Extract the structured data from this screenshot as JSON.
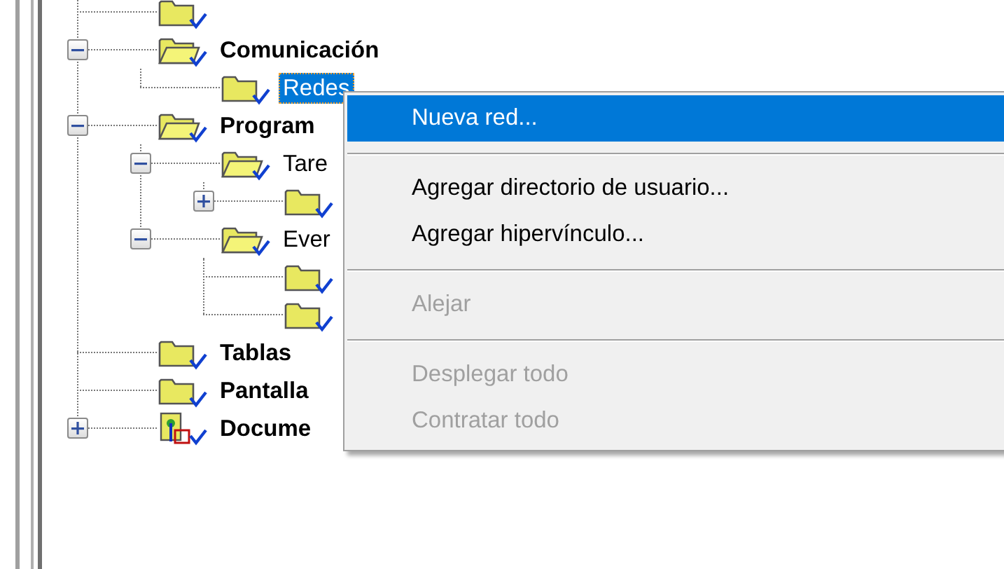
{
  "tree": [
    {
      "kind": "folder",
      "selected": false
    },
    {
      "kind": "folder",
      "label": "Comunicación",
      "expanded": true,
      "selected": false,
      "children": [
        {
          "kind": "folder",
          "label": "Redes",
          "selected": true
        }
      ]
    },
    {
      "kind": "folder",
      "label": "Program",
      "expanded": true,
      "selected": false,
      "children": [
        {
          "kind": "folder",
          "label": "Tare",
          "expanded": true,
          "selected": false,
          "children": [
            {
              "kind": "folder",
              "expanded": false,
              "selected": false
            }
          ]
        },
        {
          "kind": "folder",
          "label": "Ever",
          "expanded": true,
          "selected": false,
          "children": [
            {
              "kind": "folder",
              "selected": false
            },
            {
              "kind": "folder",
              "selected": false
            }
          ]
        }
      ]
    },
    {
      "kind": "folder",
      "label": "Tablas",
      "selected": false
    },
    {
      "kind": "folder",
      "label": "Pantalla",
      "selected": false
    },
    {
      "kind": "document",
      "label": "Docume",
      "expanded": false,
      "selected": false
    }
  ],
  "context_menu": {
    "items": [
      {
        "kind": "item",
        "label": "Nueva red...",
        "selected": true,
        "disabled": false
      },
      {
        "kind": "separator"
      },
      {
        "kind": "item",
        "label": "Agregar directorio de usuario...",
        "selected": false,
        "disabled": false
      },
      {
        "kind": "item",
        "label": "Agregar hipervínculo...",
        "selected": false,
        "disabled": false
      },
      {
        "kind": "separator"
      },
      {
        "kind": "item",
        "label": "Alejar",
        "selected": false,
        "disabled": true
      },
      {
        "kind": "separator"
      },
      {
        "kind": "item",
        "label": "Desplegar todo",
        "selected": false,
        "disabled": true
      },
      {
        "kind": "item",
        "label": "Contratar todo",
        "selected": false,
        "disabled": true
      }
    ]
  }
}
